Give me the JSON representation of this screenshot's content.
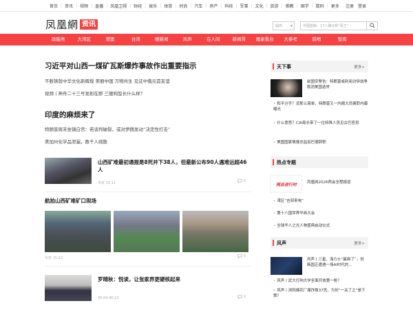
{
  "topnav": {
    "items": [
      "首页",
      "资讯",
      "视频",
      "直播",
      "凤凰卫视",
      "财经",
      "娱乐",
      "体育",
      "时尚",
      "汽车",
      "房产",
      "科技",
      "军事",
      "文化",
      "旅游",
      "佛教",
      "国学",
      "数码",
      "更多"
    ],
    "right": [
      "注册",
      "登录"
    ]
  },
  "header": {
    "logo_text": "凤凰網",
    "logo_tag": "资讯",
    "search_select": "站内",
    "search_placeholder": "中国蓝鲸：17人确诊新\"毒王\""
  },
  "channels": [
    "政能亮",
    "大湾区",
    "港澳",
    "台湾",
    "暖新闻",
    "风声",
    "在人间",
    "新闻哥",
    "凰家看台",
    "大参考",
    "前哨",
    "智库"
  ],
  "main": {
    "headline1": "习近平对山西一煤矿瓦斯爆炸事故作出重要指示",
    "sub1a": "不断铸就中华文化新辉煌  美丽中国 万物共生  见证中俄元首友谊",
    "sub1b": "视频丨神舟二十三号发射在即  三艘构型长什么样？",
    "headline2": "印度的麻烦来了",
    "sub2a": "特朗普周末坐镇白宫：若谈判破裂，或对伊朗发动“决定性打击”",
    "sub2b": "美加州化学品泄漏，数千人疏散",
    "news1_title": "山西矿难最初通报是8死并下38人，但最新公布90人遇难远超46人",
    "news1_time": "今天 15:11",
    "news1_comments": "0",
    "gallery_title": "航拍山西矿难矿口现场",
    "gallery_time": "今天 15:22",
    "gallery_comments": "0",
    "news2_title": "罗晴秋：悦读，让张家界更硬核起来",
    "news2_time": "05-04 06:10",
    "news2_comments": "0"
  },
  "side": {
    "more": "更多>",
    "sec1_title": "天下事",
    "sec1_lead": "前国安警告：特朗普或利用对伊战争取消美国选举",
    "sec1_items": [
      "和平分手？没那么简单，特朗普又一内阁大员离职内幕曝光",
      "什么意思？CIA局长带了一位特殊人员见古巴官员",
      "美国国家情报总监加巴德辞职"
    ],
    "sec2_title": "热点专题",
    "sec2_lead": "凤凰网2026两会全程报道",
    "sec2_thumb_text": "两会进行时",
    "sec2_items": [
      "湾区“吉刻来电”",
      "第十八国世界华商大会",
      "全球华人之光人物盛典启动仪式"
    ],
    "sec3_title": "风声",
    "sec3_lead": "风声丨三星、海力士“赢麻了”，但韩国正遭遇一场AI时代的…",
    "sec3_items": [
      "风声丨武大打响大学全面开放第一枪？",
      "风声丨浏阳烟花厂爆炸致37死，为何“一关了之”是下策？"
    ]
  },
  "colors": {
    "brand_red": "#f54343"
  }
}
